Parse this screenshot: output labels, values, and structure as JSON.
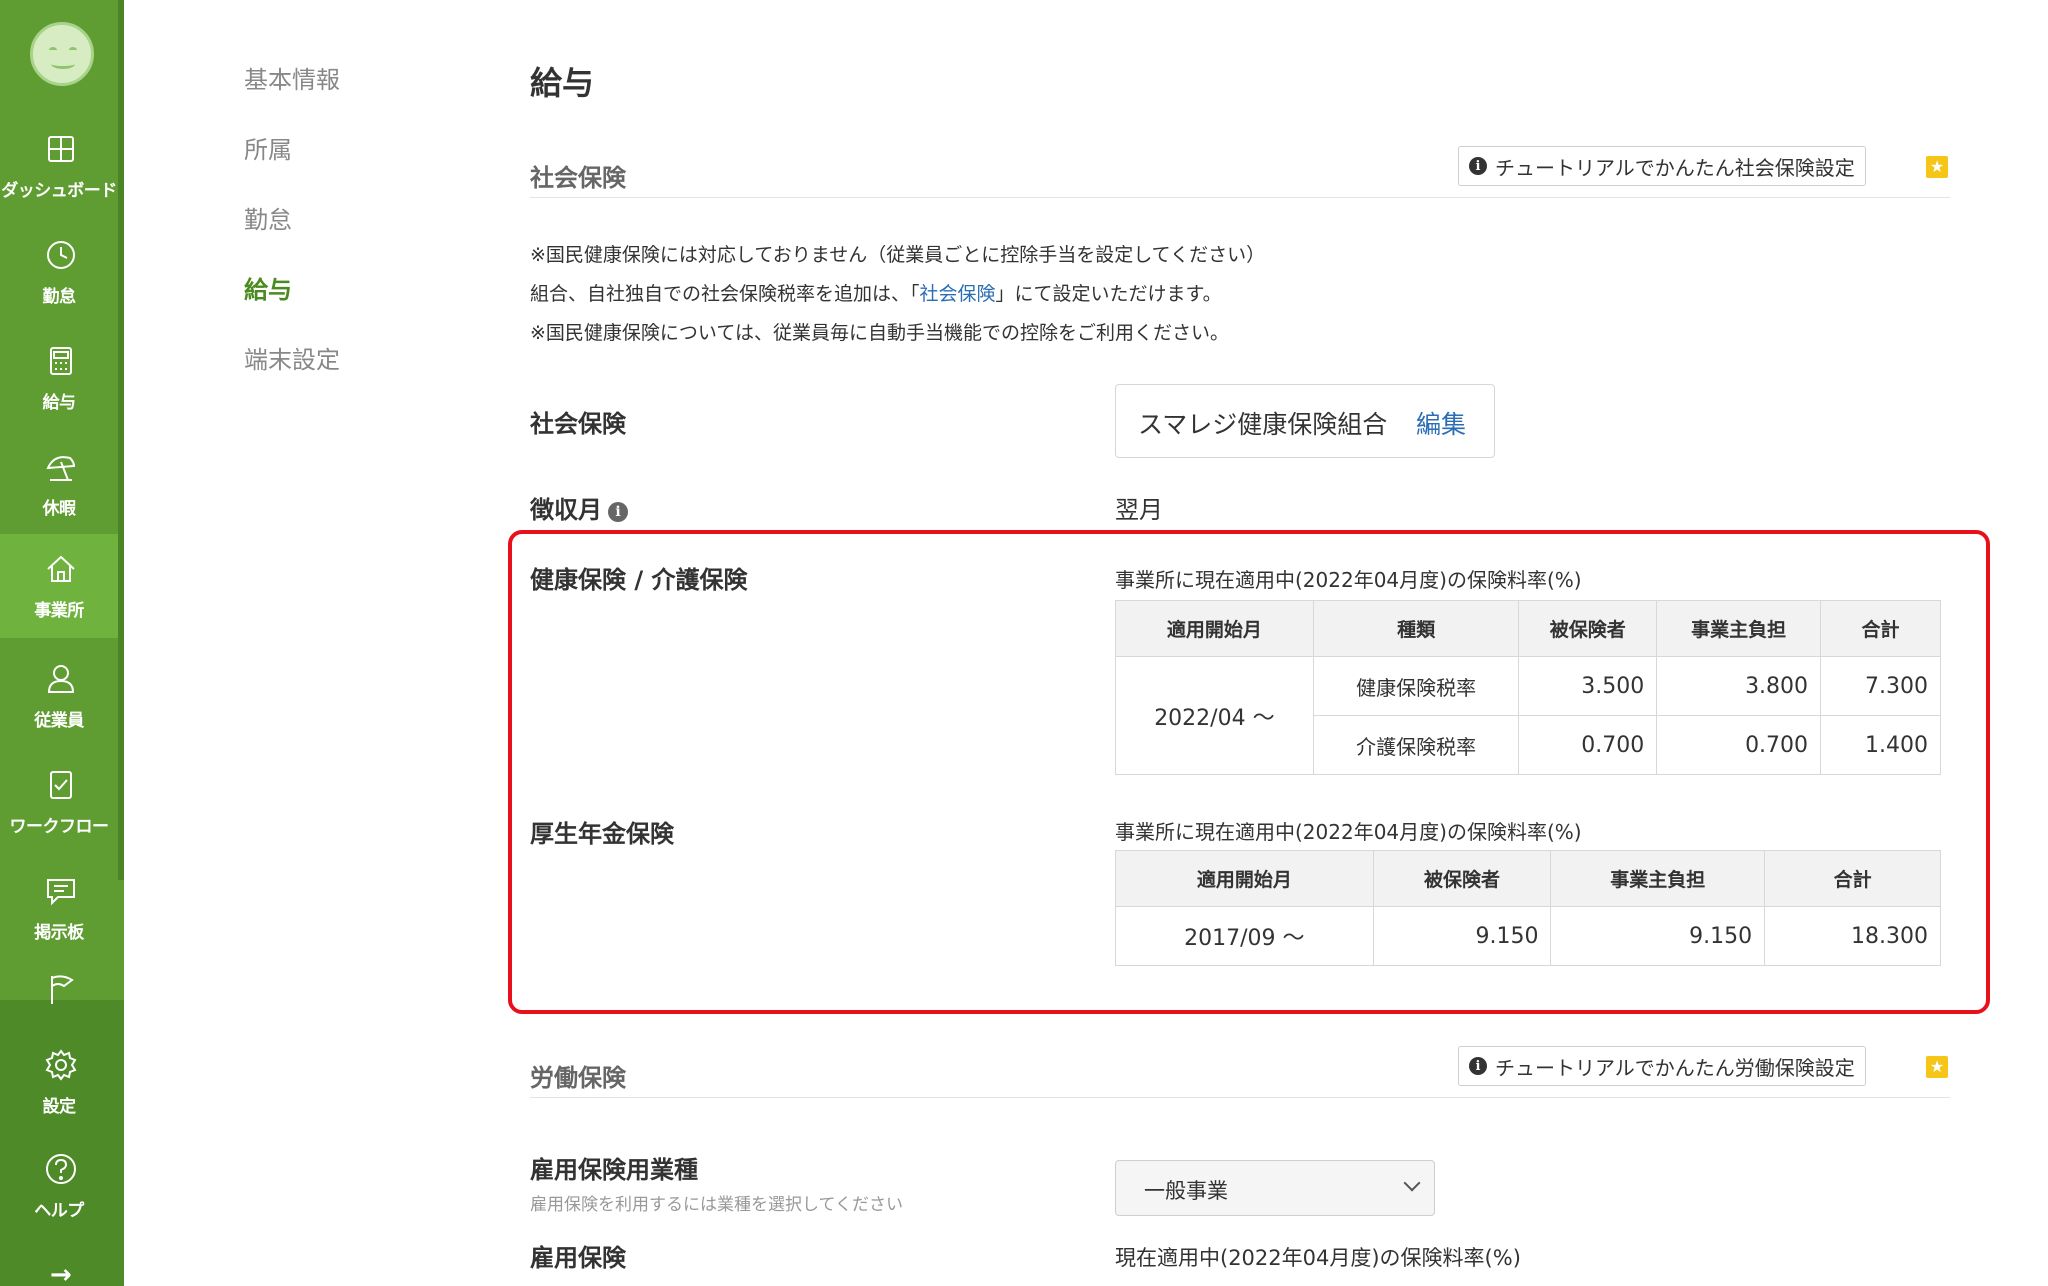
{
  "sidebar": {
    "items": [
      {
        "label": "ダッシュボード",
        "icon": "dashboard-icon"
      },
      {
        "label": "勤怠",
        "icon": "clock-icon"
      },
      {
        "label": "給与",
        "icon": "calculator-icon"
      },
      {
        "label": "休暇",
        "icon": "beach-umbrella-icon"
      },
      {
        "label": "事業所",
        "icon": "home-icon"
      },
      {
        "label": "従業員",
        "icon": "user-icon"
      },
      {
        "label": "ワークフロー",
        "icon": "clipboard-check-icon"
      },
      {
        "label": "掲示板",
        "icon": "chat-icon"
      },
      {
        "label": "",
        "icon": "flag-icon"
      },
      {
        "label": "設定",
        "icon": "gear-icon"
      },
      {
        "label": "ヘルプ",
        "icon": "help-icon"
      }
    ],
    "expand_glyph": "→"
  },
  "subnav": {
    "items": [
      "基本情報",
      "所属",
      "勤怠",
      "給与",
      "端末設定"
    ],
    "active": "給与"
  },
  "page": {
    "title": "給与"
  },
  "social": {
    "heading": "社会保険",
    "tutorial_button": "チュートリアルでかんたん社会保険設定",
    "notes": {
      "line1": "※国民健康保険には対応しておりません（従業員ごとに控除手当を設定してください）",
      "line2_pre": "組合、自社独自での社会保険税率を追加は、「",
      "line2_link": "社会保険",
      "line2_post": "」にて設定いただけます。",
      "line3": "※国民健康保険については、従業員毎に自動手当機能での控除をご利用ください。"
    },
    "insurance_label": "社会保険",
    "insurance_name": "スマレジ健康保険組合",
    "edit_label": "編集",
    "collection_label": "徴収月",
    "collection_value": "翌月"
  },
  "health": {
    "label": "健康保険 / 介護保険",
    "caption": "事業所に現在適用中(2022年04月度)の保険料率(%)",
    "headers": [
      "適用開始月",
      "種類",
      "被保険者",
      "事業主負担",
      "合計"
    ],
    "start": "2022/04 〜",
    "rows": [
      {
        "type": "健康保険税率",
        "insured": "3.500",
        "employer": "3.800",
        "total": "7.300"
      },
      {
        "type": "介護保険税率",
        "insured": "0.700",
        "employer": "0.700",
        "total": "1.400"
      }
    ]
  },
  "pension": {
    "label": "厚生年金保険",
    "caption": "事業所に現在適用中(2022年04月度)の保険料率(%)",
    "headers": [
      "適用開始月",
      "被保険者",
      "事業主負担",
      "合計"
    ],
    "row": {
      "start": "2017/09 〜",
      "insured": "9.150",
      "employer": "9.150",
      "total": "18.300"
    }
  },
  "labor": {
    "heading": "労働保険",
    "tutorial_button": "チュートリアルでかんたん労働保険設定",
    "industry_label": "雇用保険用業種",
    "industry_sub": "雇用保険を利用するには業種を選択してください",
    "industry_value": "一般事業",
    "employment_label": "雇用保険",
    "employment_caption": "現在適用中(2022年04月度)の保険料率(%)"
  },
  "colors": {
    "sidebar": "#5f9d33",
    "accent": "#4a8a1f",
    "link": "#2a6db5",
    "highlight": "#e8111b"
  }
}
